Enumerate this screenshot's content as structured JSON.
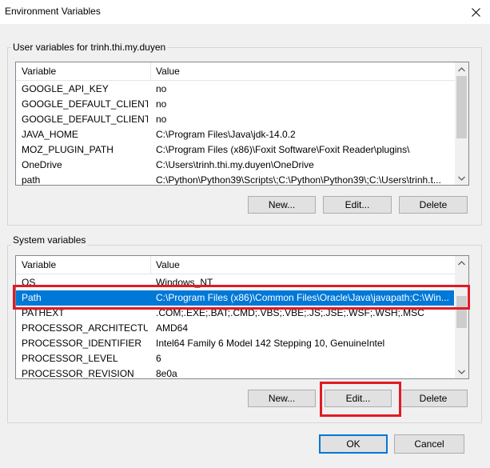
{
  "window": {
    "title": "Environment Variables",
    "close_icon": "close-icon"
  },
  "user_vars": {
    "label": "User variables for trinh.thi.my.duyen",
    "col_variable": "Variable",
    "col_value": "Value",
    "rows": [
      {
        "name": "GOOGLE_API_KEY",
        "value": "no"
      },
      {
        "name": "GOOGLE_DEFAULT_CLIENT_ID",
        "value": "no"
      },
      {
        "name": "GOOGLE_DEFAULT_CLIENT_S...",
        "value": "no"
      },
      {
        "name": "JAVA_HOME",
        "value": "C:\\Program Files\\Java\\jdk-14.0.2"
      },
      {
        "name": "MOZ_PLUGIN_PATH",
        "value": "C:\\Program Files (x86)\\Foxit Software\\Foxit Reader\\plugins\\"
      },
      {
        "name": "OneDrive",
        "value": "C:\\Users\\trinh.thi.my.duyen\\OneDrive"
      },
      {
        "name": "path",
        "value": "C:\\Python\\Python39\\Scripts\\;C:\\Python\\Python39\\;C:\\Users\\trinh.t..."
      }
    ],
    "buttons": {
      "new": "New...",
      "edit": "Edit...",
      "delete": "Delete"
    }
  },
  "system_vars": {
    "label": "System variables",
    "col_variable": "Variable",
    "col_value": "Value",
    "rows": [
      {
        "name": "OS",
        "value": "Windows_NT"
      },
      {
        "name": "Path",
        "value": "C:\\Program Files (x86)\\Common Files\\Oracle\\Java\\javapath;C:\\Win...",
        "selected": true
      },
      {
        "name": "PATHEXT",
        "value": ".COM;.EXE;.BAT;.CMD;.VBS;.VBE;.JS;.JSE;.WSF;.WSH;.MSC"
      },
      {
        "name": "PROCESSOR_ARCHITECTURE",
        "value": "AMD64"
      },
      {
        "name": "PROCESSOR_IDENTIFIER",
        "value": "Intel64 Family 6 Model 142 Stepping 10, GenuineIntel"
      },
      {
        "name": "PROCESSOR_LEVEL",
        "value": "6"
      },
      {
        "name": "PROCESSOR_REVISION",
        "value": "8e0a"
      }
    ],
    "buttons": {
      "new": "New...",
      "edit": "Edit...",
      "delete": "Delete"
    }
  },
  "footer": {
    "ok": "OK",
    "cancel": "Cancel"
  },
  "colors": {
    "selection": "#0078d7",
    "highlight": "#e01b24"
  }
}
